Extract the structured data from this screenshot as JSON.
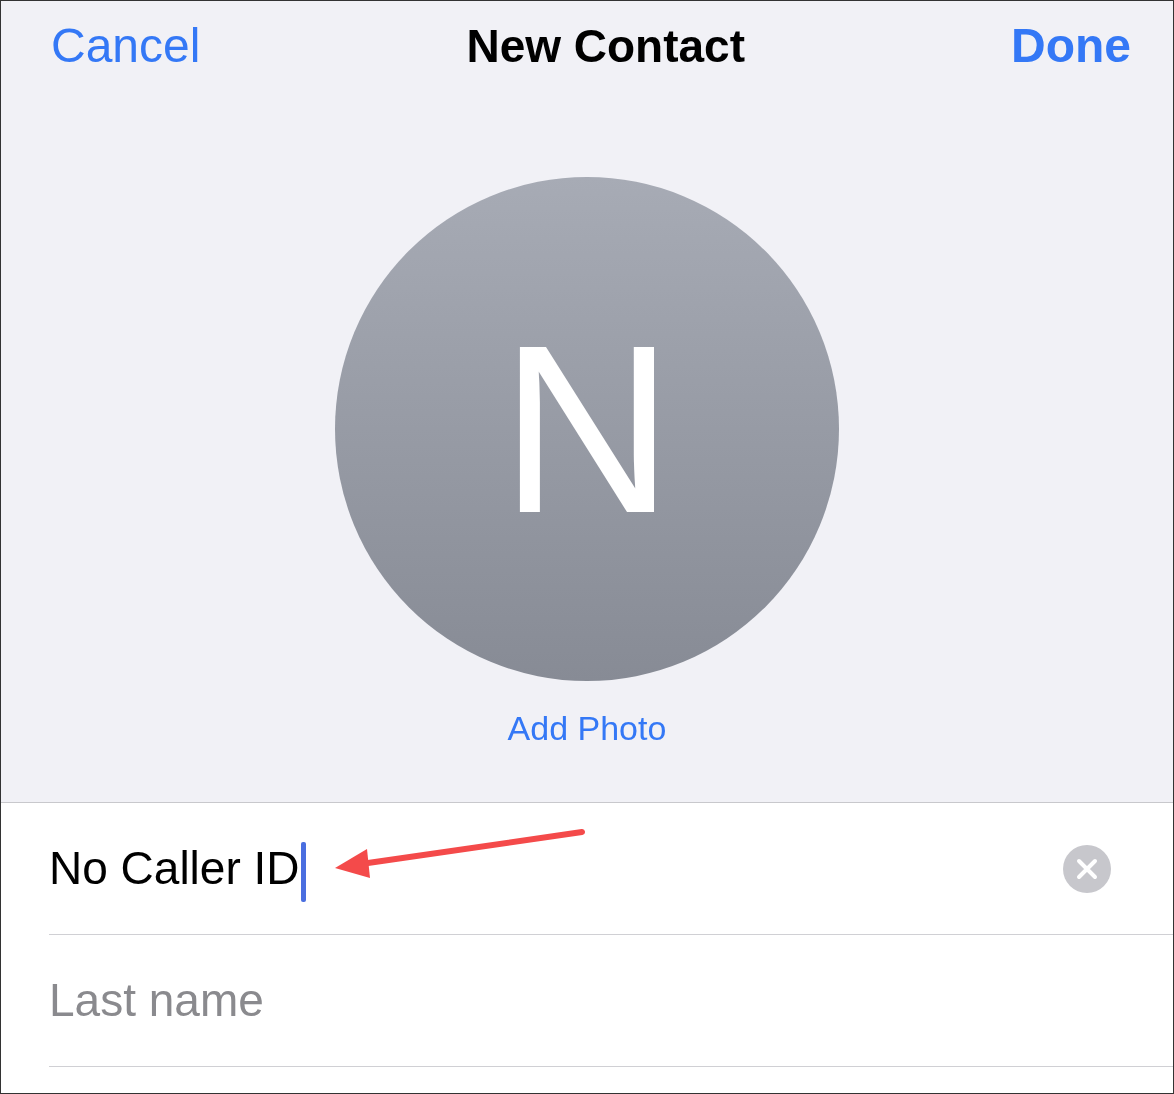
{
  "nav": {
    "cancel": "Cancel",
    "title": "New Contact",
    "done": "Done"
  },
  "avatar": {
    "initial": "N",
    "add_photo": "Add Photo"
  },
  "fields": [
    {
      "value": "No Caller ID",
      "focused": true
    },
    {
      "placeholder": "Last name",
      "focused": false
    }
  ]
}
